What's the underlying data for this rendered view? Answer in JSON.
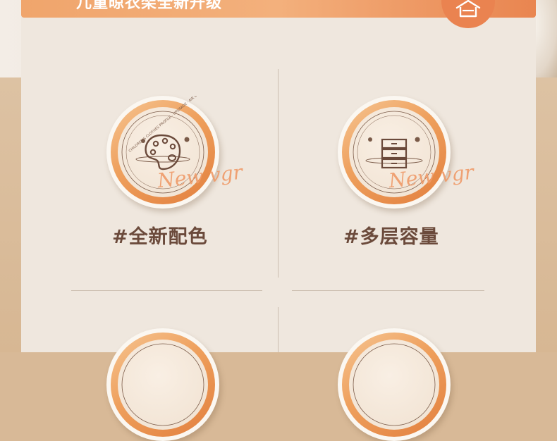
{
  "header": {
    "title": "儿童晾衣架全新升级"
  },
  "signature": "New vgr",
  "features": [
    {
      "label": "#全新配色",
      "icon": "palette-icon"
    },
    {
      "label": "#多层容量",
      "icon": "drawer-icon"
    }
  ],
  "colors": {
    "accent": "#ea8350",
    "text": "#6b4a3b",
    "panel": "#efe7de"
  }
}
